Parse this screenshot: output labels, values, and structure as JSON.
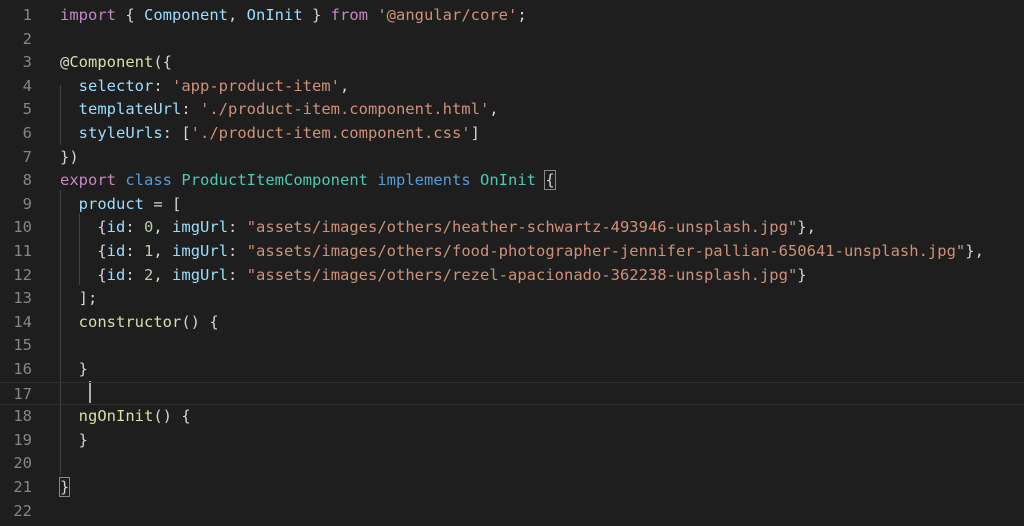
{
  "editor": {
    "colors": {
      "background": "#1e1e1e",
      "keyword": "#c586c0",
      "storage": "#569cd6",
      "type": "#4ec9b0",
      "variable": "#9cdcfe",
      "string": "#ce9178",
      "function": "#dcdcaa",
      "number": "#b5cea8",
      "punctuation": "#d4d4d4",
      "decorator_at": "#d4d4d4",
      "line_number": "#858585"
    },
    "cursor_line": 17,
    "lines": [
      {
        "n": "1",
        "tokens": [
          [
            "keyword",
            "import"
          ],
          [
            "p",
            " { "
          ],
          [
            "variable",
            "Component"
          ],
          [
            "p",
            ", "
          ],
          [
            "variable",
            "OnInit"
          ],
          [
            "p",
            " } "
          ],
          [
            "keyword",
            "from"
          ],
          [
            "p",
            " "
          ],
          [
            "string",
            "'@angular/core'"
          ],
          [
            "p",
            ";"
          ]
        ]
      },
      {
        "n": "2",
        "tokens": []
      },
      {
        "n": "3",
        "tokens": [
          [
            "p",
            "@"
          ],
          [
            "function",
            "Component"
          ],
          [
            "p",
            "({"
          ]
        ]
      },
      {
        "n": "4",
        "tokens": [
          [
            "p",
            "  "
          ],
          [
            "variable",
            "selector"
          ],
          [
            "p",
            ": "
          ],
          [
            "string",
            "'app-product-item'"
          ],
          [
            "p",
            ","
          ]
        ]
      },
      {
        "n": "5",
        "tokens": [
          [
            "p",
            "  "
          ],
          [
            "variable",
            "templateUrl"
          ],
          [
            "p",
            ": "
          ],
          [
            "string",
            "'./product-item.component.html'"
          ],
          [
            "p",
            ","
          ]
        ]
      },
      {
        "n": "6",
        "tokens": [
          [
            "p",
            "  "
          ],
          [
            "variable",
            "styleUrls"
          ],
          [
            "p",
            ": ["
          ],
          [
            "string",
            "'./product-item.component.css'"
          ],
          [
            "p",
            "]"
          ]
        ]
      },
      {
        "n": "7",
        "tokens": [
          [
            "p",
            "})"
          ]
        ]
      },
      {
        "n": "8",
        "tokens": [
          [
            "keyword",
            "export"
          ],
          [
            "p",
            " "
          ],
          [
            "storage",
            "class"
          ],
          [
            "p",
            " "
          ],
          [
            "type",
            "ProductItemComponent"
          ],
          [
            "p",
            " "
          ],
          [
            "storage",
            "implements"
          ],
          [
            "p",
            " "
          ],
          [
            "type",
            "OnInit"
          ],
          [
            "p",
            " "
          ],
          [
            "bracket",
            "{"
          ]
        ]
      },
      {
        "n": "9",
        "tokens": [
          [
            "p",
            "  "
          ],
          [
            "variable",
            "product"
          ],
          [
            "p",
            " = ["
          ]
        ]
      },
      {
        "n": "10",
        "tokens": [
          [
            "p",
            "    {"
          ],
          [
            "variable",
            "id"
          ],
          [
            "p",
            ": "
          ],
          [
            "number",
            "0"
          ],
          [
            "p",
            ", "
          ],
          [
            "variable",
            "imgUrl"
          ],
          [
            "p",
            ": "
          ],
          [
            "string",
            "\"assets/images/others/heather-schwartz-493946-unsplash.jpg\""
          ],
          [
            "p",
            "},"
          ]
        ]
      },
      {
        "n": "11",
        "tokens": [
          [
            "p",
            "    {"
          ],
          [
            "variable",
            "id"
          ],
          [
            "p",
            ": "
          ],
          [
            "number",
            "1"
          ],
          [
            "p",
            ", "
          ],
          [
            "variable",
            "imgUrl"
          ],
          [
            "p",
            ": "
          ],
          [
            "string",
            "\"assets/images/others/food-photographer-jennifer-pallian-650641-unsplash.jpg\""
          ],
          [
            "p",
            "},"
          ]
        ]
      },
      {
        "n": "12",
        "tokens": [
          [
            "p",
            "    {"
          ],
          [
            "variable",
            "id"
          ],
          [
            "p",
            ": "
          ],
          [
            "number",
            "2"
          ],
          [
            "p",
            ", "
          ],
          [
            "variable",
            "imgUrl"
          ],
          [
            "p",
            ": "
          ],
          [
            "string",
            "\"assets/images/others/rezel-apacionado-362238-unsplash.jpg\""
          ],
          [
            "p",
            "}"
          ]
        ]
      },
      {
        "n": "13",
        "tokens": [
          [
            "p",
            "  ];"
          ]
        ]
      },
      {
        "n": "14",
        "tokens": [
          [
            "p",
            "  "
          ],
          [
            "function",
            "constructor"
          ],
          [
            "p",
            "() {"
          ]
        ]
      },
      {
        "n": "15",
        "tokens": []
      },
      {
        "n": "16",
        "tokens": [
          [
            "p",
            "  }"
          ]
        ]
      },
      {
        "n": "17",
        "tokens": []
      },
      {
        "n": "18",
        "tokens": [
          [
            "p",
            "  "
          ],
          [
            "function",
            "ngOnInit"
          ],
          [
            "p",
            "() {"
          ]
        ]
      },
      {
        "n": "19",
        "tokens": [
          [
            "p",
            "  }"
          ]
        ]
      },
      {
        "n": "20",
        "tokens": []
      },
      {
        "n": "21",
        "tokens": [
          [
            "bracket",
            "}"
          ]
        ]
      },
      {
        "n": "22",
        "tokens": []
      }
    ]
  }
}
